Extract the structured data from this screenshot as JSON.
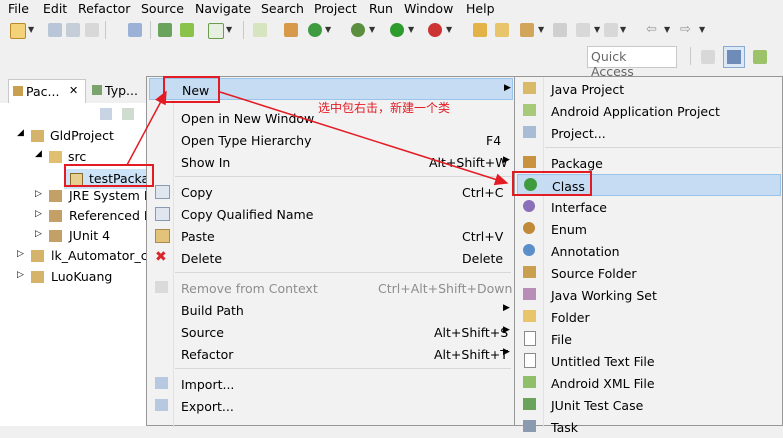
{
  "menubar": [
    "File",
    "Edit",
    "Refactor",
    "Source",
    "Navigate",
    "Search",
    "Project",
    "Run",
    "Window",
    "Help"
  ],
  "toolbar": {
    "quick_access": "Quick Access"
  },
  "view_tabs": [
    {
      "label": "Pac...",
      "close": "✕"
    },
    {
      "label": "Typ..."
    }
  ],
  "tree": {
    "items": [
      {
        "label": "GldProject"
      },
      {
        "label": "src"
      },
      {
        "label": "testPacka"
      },
      {
        "label": "JRE System L"
      },
      {
        "label": "Referenced L"
      },
      {
        "label": "JUnit 4"
      },
      {
        "label": "lk_Automator_ca"
      },
      {
        "label": "LuoKuang"
      }
    ]
  },
  "context_menu": {
    "items": [
      {
        "label": "New",
        "shortcut": "",
        "submenu": true
      },
      {
        "label": "Open in New Window",
        "shortcut": ""
      },
      {
        "label": "Open Type Hierarchy",
        "shortcut": "F4"
      },
      {
        "label": "Show In",
        "shortcut": "Alt+Shift+W",
        "submenu": true
      },
      {
        "label": "Copy",
        "shortcut": "Ctrl+C"
      },
      {
        "label": "Copy Qualified Name",
        "shortcut": ""
      },
      {
        "label": "Paste",
        "shortcut": "Ctrl+V"
      },
      {
        "label": "Delete",
        "shortcut": "Delete"
      },
      {
        "label": "Remove from Context",
        "shortcut": "Ctrl+Alt+Shift+Down",
        "disabled": true
      },
      {
        "label": "Build Path",
        "shortcut": "",
        "submenu": true
      },
      {
        "label": "Source",
        "shortcut": "Alt+Shift+S",
        "submenu": true
      },
      {
        "label": "Refactor",
        "shortcut": "Alt+Shift+T",
        "submenu": true
      },
      {
        "label": "Import...",
        "shortcut": ""
      },
      {
        "label": "Export...",
        "shortcut": ""
      }
    ]
  },
  "new_submenu": {
    "items": [
      {
        "label": "Java Project"
      },
      {
        "label": "Android Application Project"
      },
      {
        "label": "Project..."
      },
      {
        "label": "Package"
      },
      {
        "label": "Class"
      },
      {
        "label": "Interface"
      },
      {
        "label": "Enum"
      },
      {
        "label": "Annotation"
      },
      {
        "label": "Source Folder"
      },
      {
        "label": "Java Working Set"
      },
      {
        "label": "Folder"
      },
      {
        "label": "File"
      },
      {
        "label": "Untitled Text File"
      },
      {
        "label": "Android XML File"
      },
      {
        "label": "JUnit Test Case"
      },
      {
        "label": "Task"
      }
    ]
  },
  "annotation": "选中包右击，新建一个类",
  "colors": {
    "highlight": "#c6dcf3",
    "annotation_red": "#e31b23",
    "menu_bg": "#f2f2f2"
  }
}
